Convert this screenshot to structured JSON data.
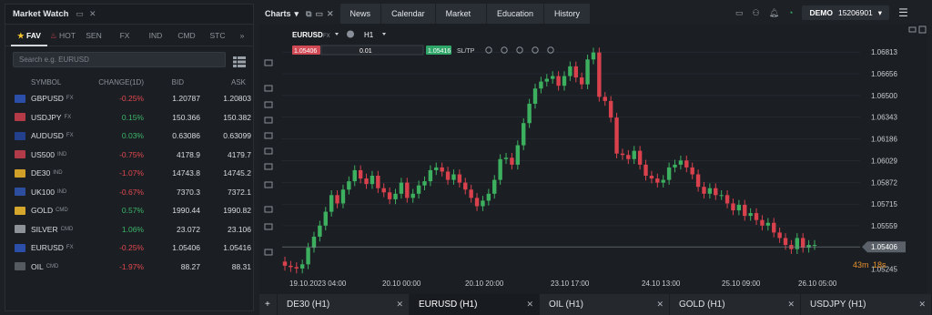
{
  "market_watch": {
    "title": "Market Watch",
    "tabs": [
      "FAV",
      "HOT",
      "SEN",
      "FX",
      "IND",
      "CMD",
      "STC"
    ],
    "search_placeholder": "Search e.g. EURUSD",
    "columns": [
      "SYMBOL",
      "CHANGE(1D)",
      "BID",
      "ASK"
    ],
    "rows": [
      {
        "symbol": "GBPUSD",
        "type": "FX",
        "change": "-0.25%",
        "bid": "1.20787",
        "ask": "1.20803",
        "dir": "neg",
        "flag": "#2b4fa8"
      },
      {
        "symbol": "USDJPY",
        "type": "FX",
        "change": "0.15%",
        "bid": "150.366",
        "ask": "150.382",
        "dir": "pos",
        "flag": "#b53a48"
      },
      {
        "symbol": "AUDUSD",
        "type": "FX",
        "change": "0.03%",
        "bid": "0.63086",
        "ask": "0.63099",
        "dir": "pos",
        "flag": "#22408c"
      },
      {
        "symbol": "US500",
        "type": "IND",
        "change": "-0.75%",
        "bid": "4178.9",
        "ask": "4179.7",
        "dir": "neg",
        "flag": "#b23b4a"
      },
      {
        "symbol": "DE30",
        "type": "IND",
        "change": "-1.07%",
        "bid": "14743.8",
        "ask": "14745.2",
        "dir": "neg",
        "flag": "#d1a028"
      },
      {
        "symbol": "UK100",
        "type": "IND",
        "change": "-0.67%",
        "bid": "7370.3",
        "ask": "7372.1",
        "dir": "neg",
        "flag": "#2d4e9e"
      },
      {
        "symbol": "GOLD",
        "type": "CMD",
        "change": "0.57%",
        "bid": "1990.44",
        "ask": "1990.82",
        "dir": "pos",
        "flag": "#d4a72c"
      },
      {
        "symbol": "SILVER",
        "type": "CMD",
        "change": "1.06%",
        "bid": "23.072",
        "ask": "23.106",
        "dir": "pos",
        "flag": "#8d9299"
      },
      {
        "symbol": "EURUSD",
        "type": "FX",
        "change": "-0.25%",
        "bid": "1.05406",
        "ask": "1.05416",
        "dir": "neg",
        "flag": "#2b4fa8"
      },
      {
        "symbol": "OIL",
        "type": "CMD",
        "change": "-1.97%",
        "bid": "88.27",
        "ask": "88.31",
        "dir": "neg",
        "flag": "#555a61"
      }
    ]
  },
  "nav": {
    "charts": "Charts",
    "tabs": [
      "News",
      "Calendar",
      "Market analysis",
      "Education",
      "History"
    ]
  },
  "account": {
    "label": "DEMO",
    "number": "15206901"
  },
  "chart_toolbar": {
    "symbol": "EURUSD",
    "symbol_type": "FX",
    "timeframe": "H1",
    "sell": "1.05406",
    "volume": "0.01",
    "buy": "1.05416",
    "sltp": "SL/TP"
  },
  "chart_data": {
    "type": "candlestick",
    "symbol": "EURUSD",
    "timeframe": "H1",
    "y_ticks": [
      "1.06813",
      "1.06656",
      "1.06500",
      "1.06343",
      "1.06186",
      "1.06029",
      "1.05872",
      "1.05715",
      "1.05559",
      "1.05406",
      "1.05245"
    ],
    "x_ticks": [
      "19.10.2023 04:00",
      "20.10 00:00",
      "20.10 20:00",
      "23.10 17:00",
      "24.10 13:00",
      "25.10 09:00",
      "26.10 05:00"
    ],
    "ylim": [
      1.0521,
      1.069
    ],
    "current_price": "1.05406",
    "countdown": {
      "min": "43m",
      "sec": "18s"
    },
    "candles_close": [
      1.0527,
      1.0526,
      1.0525,
      1.0528,
      1.054,
      1.0548,
      1.0556,
      1.0566,
      1.0578,
      1.0572,
      1.0582,
      1.0588,
      1.0596,
      1.059,
      1.0586,
      1.0592,
      1.0583,
      1.058,
      1.0575,
      1.0579,
      1.0587,
      1.0576,
      1.0579,
      1.0585,
      1.0588,
      1.0596,
      1.0598,
      1.0595,
      1.0589,
      1.0593,
      1.0587,
      1.0582,
      1.0576,
      1.057,
      1.0574,
      1.0579,
      1.0589,
      1.0604,
      1.0605,
      1.06,
      1.0614,
      1.063,
      1.0644,
      1.0655,
      1.066,
      1.0662,
      1.0664,
      1.0657,
      1.0664,
      1.0671,
      1.0663,
      1.0658,
      1.0676,
      1.0681,
      1.0649,
      1.0646,
      1.0634,
      1.0608,
      1.0607,
      1.0604,
      1.061,
      1.06,
      1.0592,
      1.059,
      1.0587,
      1.0589,
      1.0598,
      1.06,
      1.0603,
      1.0598,
      1.0593,
      1.0584,
      1.0579,
      1.0583,
      1.0578,
      1.0578,
      1.0572,
      1.0567,
      1.0571,
      1.0563,
      1.0565,
      1.056,
      1.0556,
      1.0558,
      1.0551,
      1.0547,
      1.0542,
      1.0539,
      1.0547,
      1.054,
      1.0542,
      1.0542
    ]
  },
  "bottom_tabs": [
    "DE30 (H1)",
    "EURUSD (H1)",
    "OIL (H1)",
    "GOLD (H1)",
    "USDJPY (H1)"
  ]
}
